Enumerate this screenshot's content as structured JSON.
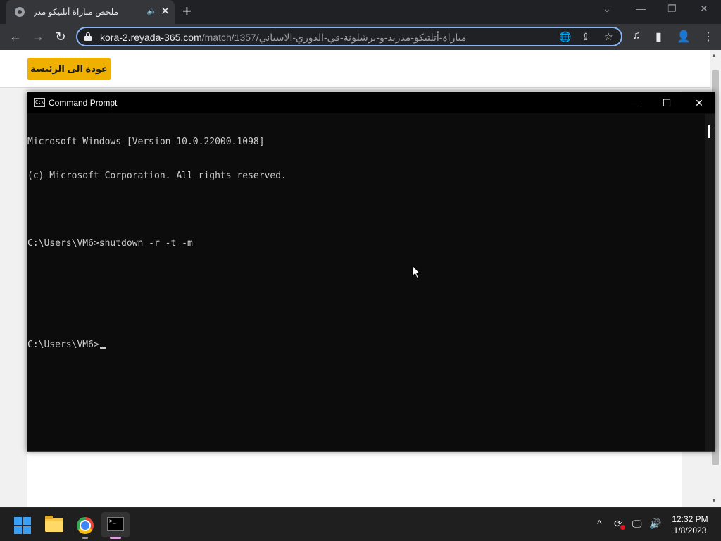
{
  "browser": {
    "tab": {
      "title": "ملخص مباراة أتلتيكو مدريد ضد برشلونة",
      "audio_icon": "🔈",
      "close_icon": "✕"
    },
    "new_tab_icon": "+",
    "window_controls": {
      "tab_search": "⌄",
      "minimize": "—",
      "restore": "❐",
      "close": "✕"
    },
    "nav": {
      "back": "←",
      "forward": "→",
      "reload": "↻"
    },
    "address": {
      "host": "kora-2.reyada-365.com",
      "path": "/match/1357/مباراة-أتلتيكو-مدريد-و-برشلونة-في-الدوري-الاسباني"
    },
    "omnibox_icons": {
      "translate": "🌐",
      "share": "⇪",
      "bookmark": "☆"
    },
    "toolbar_icons": {
      "media": "♫",
      "side_panel": "▮",
      "profile": "👤",
      "menu": "⋮"
    }
  },
  "page": {
    "home_button_label": "عودة الى الرئيسة"
  },
  "cmd": {
    "title": "Command Prompt",
    "icon_text": "C:\\",
    "controls": {
      "minimize": "—",
      "maximize": "☐",
      "close": "✕"
    },
    "lines": [
      "Microsoft Windows [Version 10.0.22000.1098]",
      "(c) Microsoft Corporation. All rights reserved.",
      "",
      "C:\\Users\\VM6>shutdown -r -t -m",
      "",
      "",
      "C:\\Users\\VM6>"
    ]
  },
  "taskbar": {
    "terminal_icon_text": ">_",
    "tray": {
      "chevron": "^",
      "sync": "⟳",
      "network": "🖵",
      "volume": "🔊"
    },
    "clock": {
      "time": "12:32 PM",
      "date": "1/8/2023"
    }
  }
}
